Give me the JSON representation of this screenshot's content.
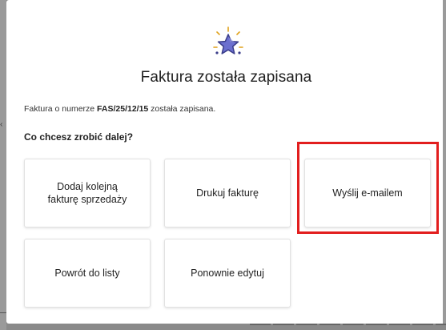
{
  "dialog": {
    "title": "Faktura została zapisana",
    "message": {
      "prefix": "Faktura o numerze ",
      "invoice_number": "FAS/25/12/15",
      "suffix": " została zapisana."
    },
    "question": "Co chcesz zrobić dalej?",
    "icon": "star-icon",
    "actions": [
      {
        "label": "Dodaj kolejną\nfakturę sprzedaży"
      },
      {
        "label": "Drukuj fakturę"
      },
      {
        "label": "Wyślij e-mailem"
      },
      {
        "label": "Powrót do listy"
      },
      {
        "label": "Ponownie edytuj"
      }
    ]
  },
  "background": {
    "partial_text": "‹"
  },
  "colors": {
    "highlight": "#e21e1e",
    "star_fill": "#6b6fcf",
    "star_stroke": "#3a3d8a",
    "sparkle": "#e0a11b"
  }
}
